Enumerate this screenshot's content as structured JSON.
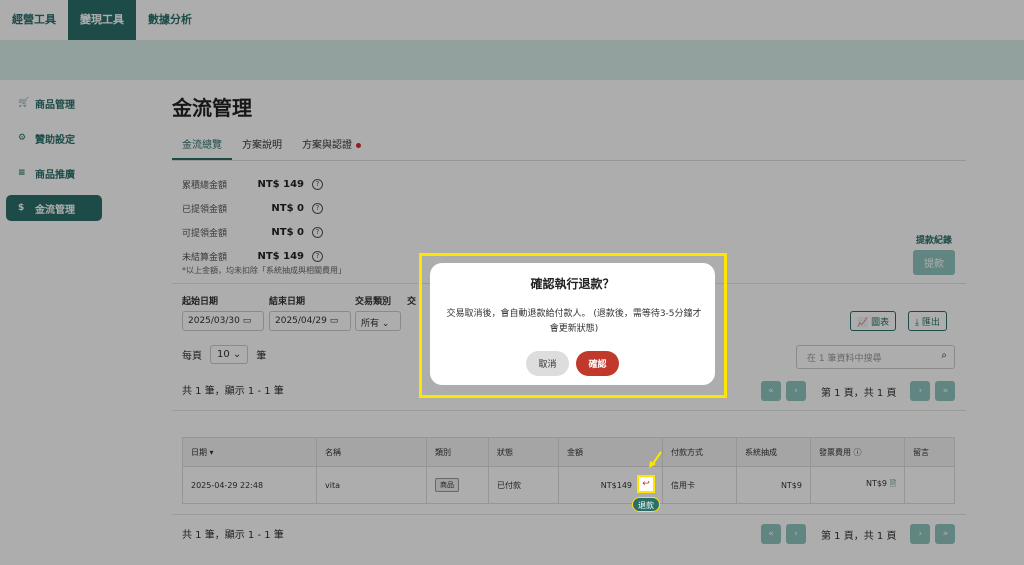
{
  "topnav": {
    "tabs": [
      "經營工具",
      "變現工具",
      "數據分析"
    ],
    "active": 1
  },
  "sidebar": {
    "items": [
      {
        "icon": "cart-icon",
        "glyph": "🛒",
        "label": "商品管理"
      },
      {
        "icon": "gear-icon",
        "glyph": "⚙",
        "label": "贊助設定"
      },
      {
        "icon": "stack-icon",
        "glyph": "≡",
        "label": "商品推廣"
      },
      {
        "icon": "dollar-icon",
        "glyph": "$",
        "label": "金流管理"
      }
    ],
    "active": 3
  },
  "page": {
    "title": "金流管理"
  },
  "tabs": [
    "金流總覽",
    "方案說明",
    "方案與認證"
  ],
  "summary": {
    "rows": [
      {
        "label": "累積總金額",
        "value": "NT$ 149"
      },
      {
        "label": "已提領金額",
        "value": "NT$ 0"
      },
      {
        "label": "可提領金額",
        "value": "NT$ 0"
      },
      {
        "label": "未結算金額",
        "value": "NT$ 149"
      }
    ],
    "note": "*以上金額，均未扣除「系統抽成與相關費用」"
  },
  "withdraw": {
    "log": "提款紀錄",
    "button": "提款"
  },
  "filters": {
    "start_label": "起始日期",
    "start_value": "2025/03/30",
    "end_label": "結束日期",
    "end_value": "2025/04/29",
    "type_label": "交易類別",
    "type_value": "所有",
    "trade_label": "交",
    "chart_btn": "圖表",
    "export_btn": "匯出"
  },
  "list": {
    "perpage_label": "每頁",
    "perpage_value": "10",
    "perpage_unit": "筆",
    "search_placeholder": "在 1 筆資料中搜尋",
    "count_text": "共 1 筆，顯示 1 - 1 筆",
    "page_text": "第 1 頁，共 1 頁"
  },
  "table": {
    "headers": [
      "日期",
      "名稱",
      "類別",
      "狀態",
      "金額",
      "付款方式",
      "系統抽成",
      "發票費用",
      "留言"
    ],
    "rows": [
      {
        "date": "2025-04-29 22:48",
        "name": "vita",
        "category": "商品",
        "status": "已付款",
        "amount": "NT$149",
        "payment": "信用卡",
        "fee": "NT$9",
        "invoice": "NT$9",
        "message": ""
      }
    ]
  },
  "modal": {
    "title": "確認執行退款？",
    "body": "交易取消後，會自動退款給付款人。 (退款後，需等待3-5分鐘才會更新狀態)",
    "cancel": "取消",
    "confirm": "確認"
  },
  "refund_tip": "退款",
  "colors": {
    "brand": "#2a6f6a",
    "brand_light": "#8fc6bf",
    "danger": "#c0392b",
    "highlight": "#ffe600"
  }
}
